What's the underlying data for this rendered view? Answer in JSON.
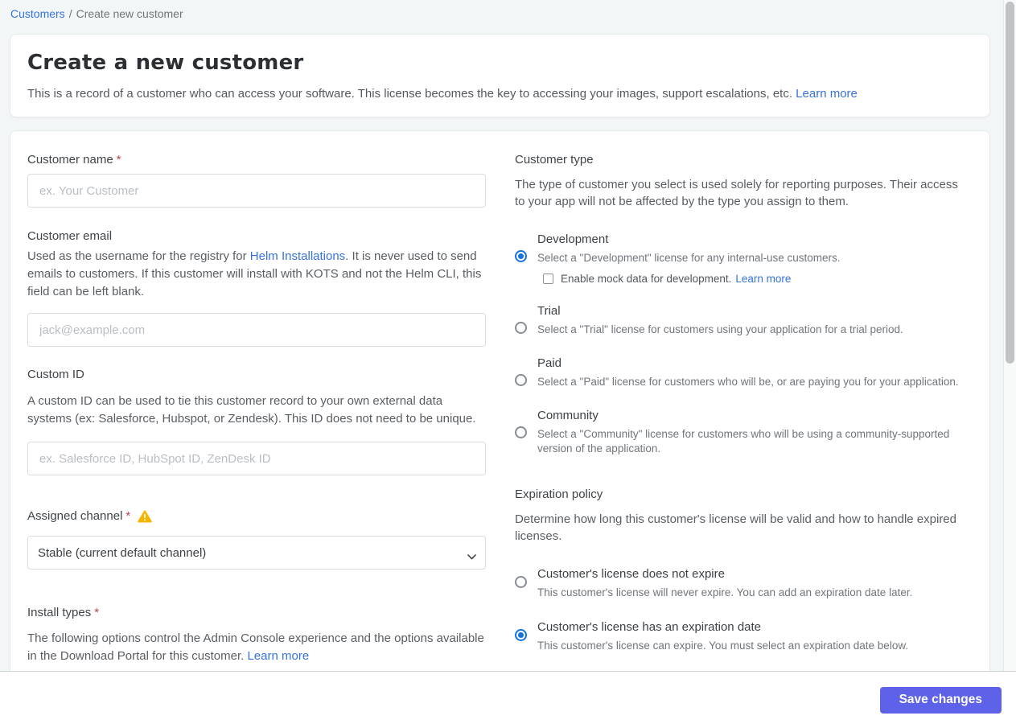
{
  "breadcrumb": {
    "link": "Customers",
    "separator": "/",
    "current": "Create new customer"
  },
  "header": {
    "title": "Create a new customer",
    "description": "This is a record of a customer who can access your software. This license becomes the key to accessing your images, support escalations, etc.",
    "learn_more": "Learn more"
  },
  "form": {
    "customer_name": {
      "label": "Customer name",
      "required_mark": "*",
      "placeholder": "ex. Your Customer",
      "value": ""
    },
    "customer_email": {
      "label": "Customer email",
      "description_before_link": "Used as the username for the registry for ",
      "description_link": "Helm Installations",
      "description_after_link": ". It is never used to send emails to customers. If this customer will install with KOTS and not the Helm CLI, this field can be left blank.",
      "placeholder": "jack@example.com",
      "value": ""
    },
    "custom_id": {
      "label": "Custom ID",
      "description": "A custom ID can be used to tie this customer record to your own external data systems (ex: Salesforce, Hubspot, or Zendesk). This ID does not need to be unique.",
      "placeholder": "ex. Salesforce ID, HubSpot ID, ZenDesk ID",
      "value": ""
    },
    "assigned_channel": {
      "label": "Assigned channel",
      "required_mark": "*",
      "selected_option": "Stable (current default channel)"
    },
    "install_types": {
      "label": "Install types",
      "required_mark": "*",
      "description": "The following options control the Admin Console experience and the options available in the Download Portal for this customer.",
      "learn_more": "Learn more"
    }
  },
  "customer_type": {
    "title": "Customer type",
    "description": "The type of customer you select is used solely for reporting purposes. Their access to your app will not be affected by the type you assign to them.",
    "options": [
      {
        "name": "Development",
        "selected": true,
        "description": "Select a \"Development\" license for any internal-use customers.",
        "checkbox": {
          "label": "Enable mock data for development.",
          "learn_more": "Learn more",
          "checked": false
        }
      },
      {
        "name": "Trial",
        "selected": false,
        "description": "Select a \"Trial\" license for customers using your application for a trial period."
      },
      {
        "name": "Paid",
        "selected": false,
        "description": "Select a \"Paid\" license for customers who will be, or are paying you for your application."
      },
      {
        "name": "Community",
        "selected": false,
        "description": "Select a \"Community\" license for customers who will be using a community-supported version of the application."
      }
    ]
  },
  "expiration_policy": {
    "title": "Expiration policy",
    "description": "Determine how long this customer's license will be valid and how to handle expired licenses.",
    "options": [
      {
        "name": "Customer's license does not expire",
        "selected": false,
        "description": "This customer's license will never expire. You can add an expiration date later."
      },
      {
        "name": "Customer's license has an expiration date",
        "selected": true,
        "description": "This customer's license can expire. You must select an expiration date below."
      }
    ]
  },
  "footer": {
    "save_label": "Save changes"
  },
  "icons": {
    "assigned_channel_warning": "warning-triangle-icon",
    "select_chevron": "chevron-down-icon"
  },
  "colors": {
    "link": "#3673dd",
    "save_button": "#5d62e8",
    "radio_selected": "#1273de",
    "warning": "#f7b500",
    "required_mark": "#b5464b",
    "page_background": "#f2f6f7"
  }
}
